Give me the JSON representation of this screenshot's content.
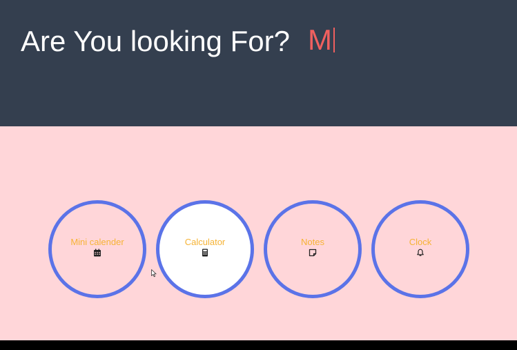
{
  "header": {
    "headline": "Are You looking For?",
    "typed_text": "M"
  },
  "apps": [
    {
      "label": "Mini calender",
      "icon": "calendar-icon",
      "active": false
    },
    {
      "label": "Calculator",
      "icon": "calculator-icon",
      "active": true
    },
    {
      "label": "Notes",
      "icon": "sticky-note-icon",
      "active": false
    },
    {
      "label": "Clock",
      "icon": "bell-icon",
      "active": false
    }
  ],
  "colors": {
    "header_bg": "#343f4f",
    "content_bg": "#ffd6d9",
    "circle_border": "#5b73e8",
    "label_text": "#f6b335",
    "typed_text": "#f0605f"
  }
}
